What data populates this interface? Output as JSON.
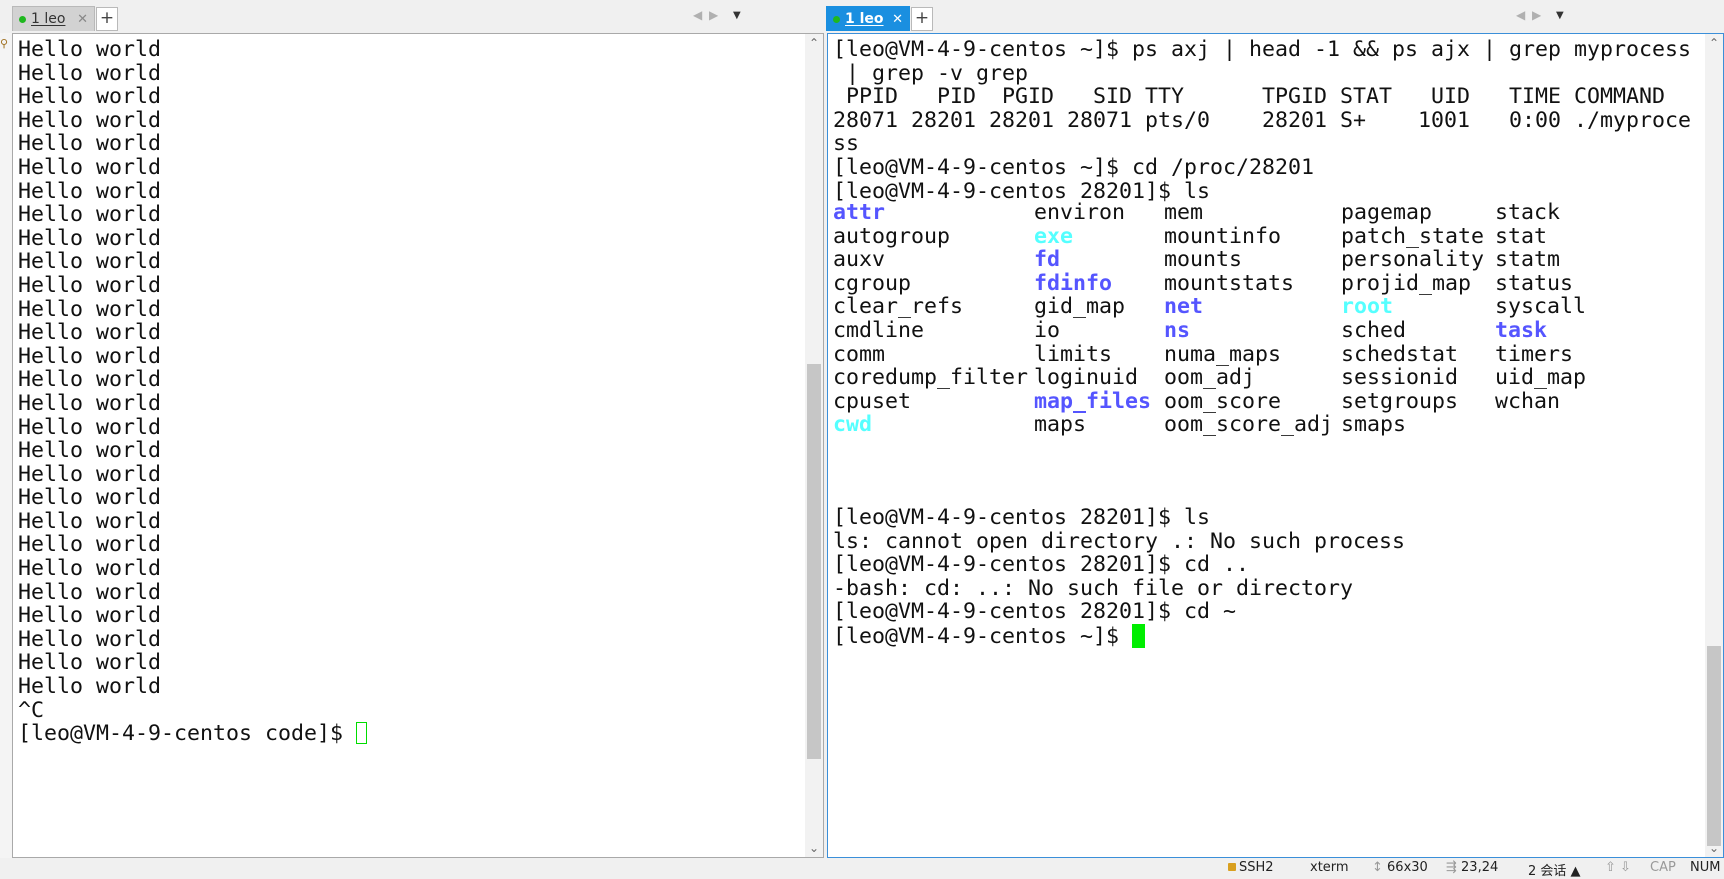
{
  "left_tab": {
    "label": "1 leo",
    "close": "✕",
    "new_tab": "+"
  },
  "right_tab": {
    "label": "1 leo",
    "close": "✕",
    "new_tab": "+"
  },
  "nav": {
    "prev": "◀",
    "next": "▶",
    "menu": "▼"
  },
  "left_terminal": {
    "lines": [
      "Hello world",
      "Hello world",
      "Hello world",
      "Hello world",
      "Hello world",
      "Hello world",
      "Hello world",
      "Hello world",
      "Hello world",
      "Hello world",
      "Hello world",
      "Hello world",
      "Hello world",
      "Hello world",
      "Hello world",
      "Hello world",
      "Hello world",
      "Hello world",
      "Hello world",
      "Hello world",
      "Hello world",
      "Hello world",
      "Hello world",
      "Hello world",
      "Hello world",
      "Hello world",
      "Hello world",
      "Hello world",
      "^C"
    ],
    "prompt": "[leo@VM-4-9-centos code]$ "
  },
  "right_terminal": {
    "top_lines": [
      "[leo@VM-4-9-centos ~]$ ps axj | head -1 && ps ajx | grep myprocess",
      " | grep -v grep",
      " PPID   PID  PGID   SID TTY      TPGID STAT   UID   TIME COMMAND",
      "28071 28201 28201 28071 pts/0    28201 S+    1001   0:00 ./myproce",
      "ss",
      "[leo@VM-4-9-centos ~]$ cd /proc/28201",
      "[leo@VM-4-9-centos 28201]$ ls"
    ],
    "ls_columns": [
      [
        {
          "name": "attr",
          "kind": "dir"
        },
        {
          "name": "autogroup",
          "kind": "file"
        },
        {
          "name": "auxv",
          "kind": "file"
        },
        {
          "name": "cgroup",
          "kind": "file"
        },
        {
          "name": "clear_refs",
          "kind": "file"
        },
        {
          "name": "cmdline",
          "kind": "file"
        },
        {
          "name": "comm",
          "kind": "file"
        },
        {
          "name": "coredump_filter",
          "kind": "file"
        },
        {
          "name": "cpuset",
          "kind": "file"
        },
        {
          "name": "cwd",
          "kind": "link"
        }
      ],
      [
        {
          "name": "environ",
          "kind": "file"
        },
        {
          "name": "exe",
          "kind": "link"
        },
        {
          "name": "fd",
          "kind": "dir"
        },
        {
          "name": "fdinfo",
          "kind": "dir"
        },
        {
          "name": "gid_map",
          "kind": "file"
        },
        {
          "name": "io",
          "kind": "file"
        },
        {
          "name": "limits",
          "kind": "file"
        },
        {
          "name": "loginuid",
          "kind": "file"
        },
        {
          "name": "map_files",
          "kind": "dir"
        },
        {
          "name": "maps",
          "kind": "file"
        }
      ],
      [
        {
          "name": "mem",
          "kind": "file"
        },
        {
          "name": "mountinfo",
          "kind": "file"
        },
        {
          "name": "mounts",
          "kind": "file"
        },
        {
          "name": "mountstats",
          "kind": "file"
        },
        {
          "name": "net",
          "kind": "dir"
        },
        {
          "name": "ns",
          "kind": "dir"
        },
        {
          "name": "numa_maps",
          "kind": "file"
        },
        {
          "name": "oom_adj",
          "kind": "file"
        },
        {
          "name": "oom_score",
          "kind": "file"
        },
        {
          "name": "oom_score_adj",
          "kind": "file"
        }
      ],
      [
        {
          "name": "pagemap",
          "kind": "file"
        },
        {
          "name": "patch_state",
          "kind": "file"
        },
        {
          "name": "personality",
          "kind": "file"
        },
        {
          "name": "projid_map",
          "kind": "file"
        },
        {
          "name": "root",
          "kind": "link"
        },
        {
          "name": "sched",
          "kind": "file"
        },
        {
          "name": "schedstat",
          "kind": "file"
        },
        {
          "name": "sessionid",
          "kind": "file"
        },
        {
          "name": "setgroups",
          "kind": "file"
        },
        {
          "name": "smaps",
          "kind": "file"
        }
      ],
      [
        {
          "name": "stack",
          "kind": "file"
        },
        {
          "name": "stat",
          "kind": "file"
        },
        {
          "name": "statm",
          "kind": "file"
        },
        {
          "name": "status",
          "kind": "file"
        },
        {
          "name": "syscall",
          "kind": "file"
        },
        {
          "name": "task",
          "kind": "dir"
        },
        {
          "name": "timers",
          "kind": "file"
        },
        {
          "name": "uid_map",
          "kind": "file"
        },
        {
          "name": "wchan",
          "kind": "file"
        }
      ]
    ],
    "bottom_lines": [
      "[leo@VM-4-9-centos 28201]$ ls",
      "ls: cannot open directory .: No such process",
      "[leo@VM-4-9-centos 28201]$ cd ..",
      "-bash: cd: ..: No such file or directory",
      "[leo@VM-4-9-centos 28201]$ cd ~"
    ],
    "prompt": "[leo@VM-4-9-centos ~]$ "
  },
  "colors": {
    "dir": "#5555ff",
    "link": "#55ffff",
    "cursor": "#00ee00",
    "active_tab": "#1a8fe0"
  },
  "statusbar": {
    "protocol": "SSH2",
    "terminal_type": "xterm",
    "size": "66x30",
    "cursor_pos": "23,24",
    "sessions": "2 会话",
    "caps": "CAP",
    "num": "NUM"
  }
}
